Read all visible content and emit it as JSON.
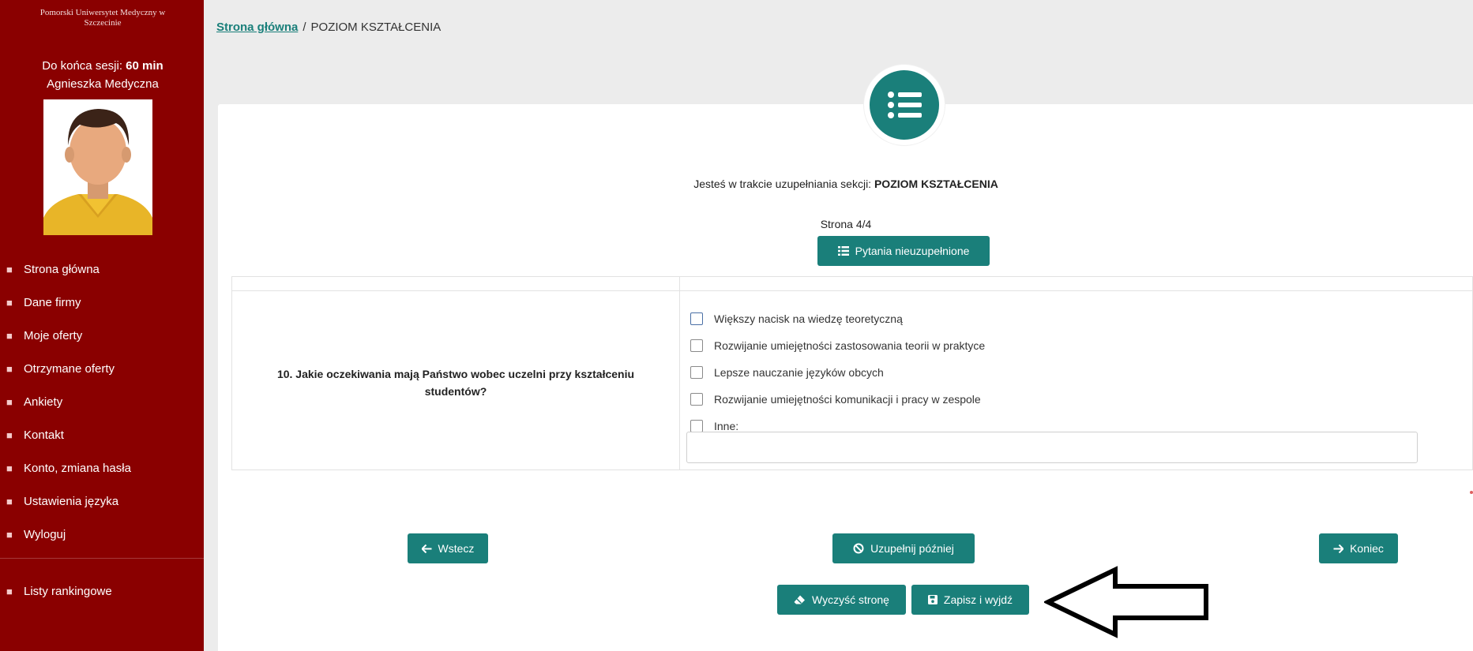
{
  "sidebar": {
    "university_name": "Pomorski Uniwersytet Medyczny w Szczecinie",
    "session_prefix": "Do końca sesji:",
    "session_value": "60",
    "session_unit": "min",
    "user_name": "Agnieszka Medyczna",
    "menu": [
      {
        "label": "Strona główna",
        "icon": "home-icon"
      },
      {
        "label": "Dane firmy",
        "icon": "building-icon"
      },
      {
        "label": "Moje oferty",
        "icon": "offer-icon"
      },
      {
        "label": "Otrzymane oferty",
        "icon": "inbox-icon"
      },
      {
        "label": "Ankiety",
        "icon": "survey-icon"
      },
      {
        "label": "Kontakt",
        "icon": "contact-icon"
      },
      {
        "label": "Konto, zmiana hasła",
        "icon": "account-icon"
      },
      {
        "label": "Ustawienia języka",
        "icon": "language-icon"
      },
      {
        "label": "Wyloguj",
        "icon": "logout-icon"
      }
    ],
    "extra_menu": [
      {
        "label": "Listy rankingowe",
        "icon": "ranking-icon"
      }
    ]
  },
  "breadcrumb": {
    "home": "Strona główna",
    "separator": "/",
    "current": "POZIOM KSZTAŁCENIA"
  },
  "section": {
    "intro": "Jesteś w trakcie uzupełniania sekcji:",
    "name": "POZIOM KSZTAŁCENIA",
    "page_label": "Strona 4/4",
    "unanswered_button": "Pytania nieuzupełnione"
  },
  "question": {
    "text": "10. Jakie oczekiwania mają Państwo wobec uczelni przy kształceniu studentów?",
    "options": [
      "Większy nacisk na wiedzę teoretyczną",
      "Rozwijanie umiejętności zastosowania teorii w praktyce",
      "Lepsze nauczanie języków obcych",
      "Rozwijanie umiejętności komunikacji i pracy w zespole",
      "Inne:"
    ],
    "other_value": ""
  },
  "buttons": {
    "back": "Wstecz",
    "later": "Uzupełnij później",
    "end": "Koniec",
    "clear": "Wyczyść stronę",
    "save_exit": "Zapisz i wyjdź"
  },
  "colors": {
    "sidebar": "#8a0000",
    "accent": "#1a7f7a",
    "background": "#ececec"
  }
}
